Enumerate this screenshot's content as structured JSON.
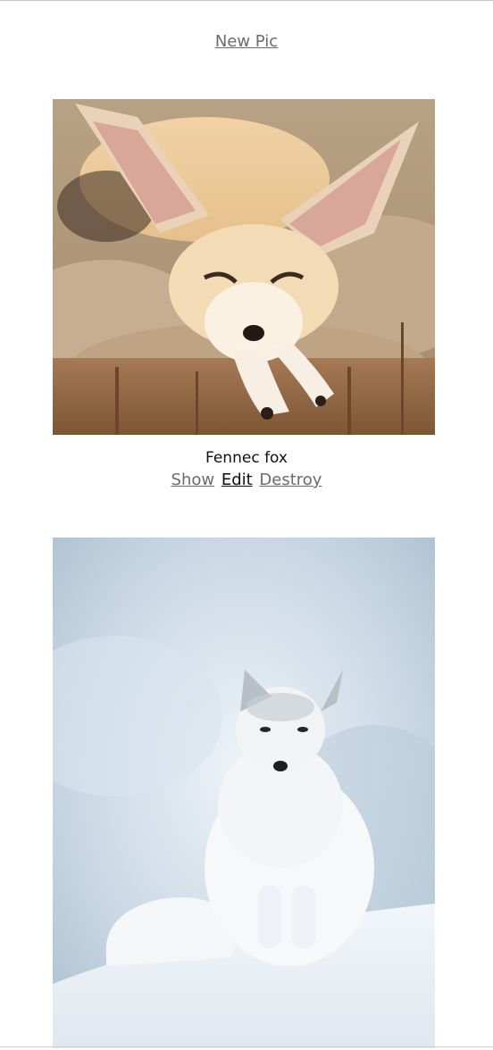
{
  "header": {
    "new_pic_label": "New Pic"
  },
  "pics": [
    {
      "caption": "Fennec fox",
      "actions": {
        "show": "Show",
        "edit": "Edit",
        "destroy": "Destroy"
      }
    },
    {}
  ],
  "colors": {
    "link": "#6b6b6b",
    "link_active": "#111111",
    "text": "#111111",
    "background": "#ffffff"
  }
}
